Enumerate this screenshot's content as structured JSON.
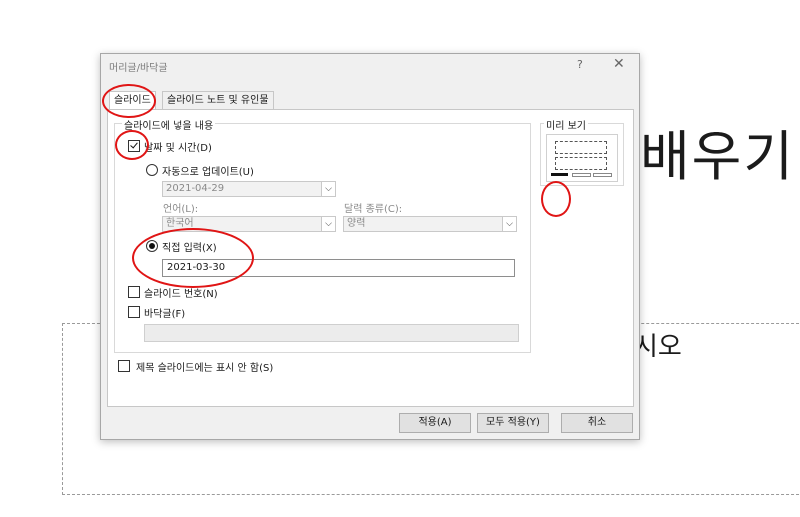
{
  "slide": {
    "title_fragment": "배우기",
    "body_fragment": "시오"
  },
  "dialog": {
    "title": "머리글/바닥글",
    "help_glyph": "?",
    "close_glyph": "✕",
    "tabs": [
      {
        "label": "슬라이드",
        "active": true
      },
      {
        "label": "슬라이드 노트 및 유인물",
        "active": false
      }
    ],
    "include_group": {
      "legend": "슬라이드에 넣을 내용",
      "date_time": {
        "label": "날짜 및 시간(D)",
        "checked": true
      },
      "auto_update": {
        "label": "자동으로 업데이트(U)",
        "selected": false
      },
      "auto_date_value": "2021-04-29",
      "language_label": "언어(L):",
      "language_value": "한국어",
      "calendar_label": "달력 종류(C):",
      "calendar_value": "양력",
      "fixed": {
        "label": "직접 입력(X)",
        "selected": true
      },
      "fixed_value": "2021-03-30",
      "slide_number": {
        "label": "슬라이드 번호(N)",
        "checked": false
      },
      "footer": {
        "label": "바닥글(F)",
        "checked": false
      },
      "footer_value": ""
    },
    "dont_show_title": {
      "label": "제목 슬라이드에는 표시 안 함(S)",
      "checked": false
    },
    "preview": {
      "legend": "미리 보기"
    },
    "buttons": {
      "apply": "적용(A)",
      "apply_all": "모두 적용(Y)",
      "cancel": "취소"
    }
  },
  "annotations": {
    "ring_color": "#e01515"
  }
}
